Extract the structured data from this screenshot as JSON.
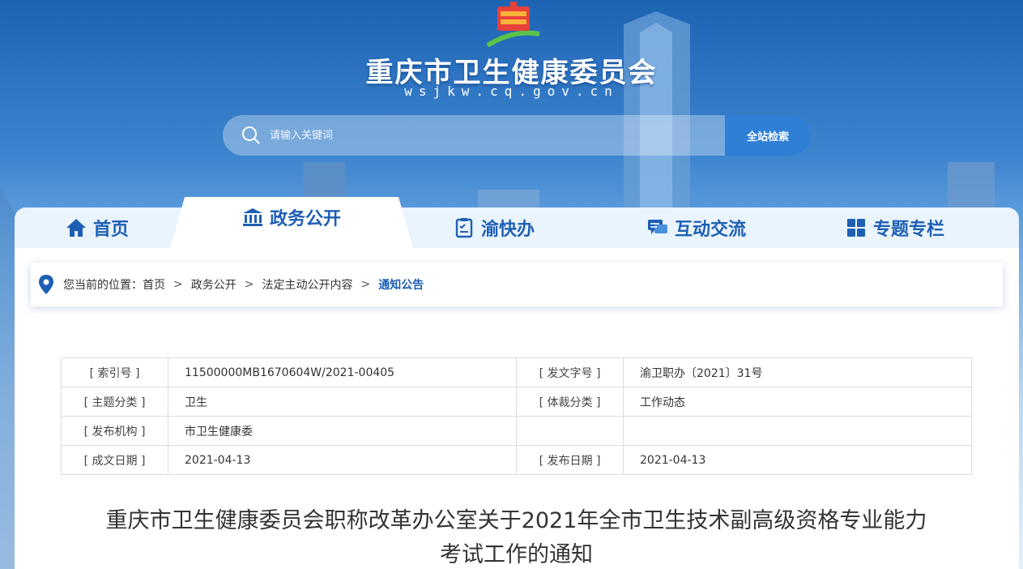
{
  "header": {
    "site_title": "重庆市卫生健康委员会",
    "site_domain": "wsjkw.cq.gov.cn"
  },
  "search": {
    "placeholder": "请输入关键词",
    "button_label": "全站检索"
  },
  "nav": {
    "items": [
      {
        "label": "首页",
        "icon": "home-icon"
      },
      {
        "label": "政务公开",
        "icon": "government-building-icon",
        "active": true
      },
      {
        "label": "渝快办",
        "icon": "clipboard-check-icon"
      },
      {
        "label": "互动交流",
        "icon": "chat-bubbles-icon"
      },
      {
        "label": "专题专栏",
        "icon": "grid-squares-icon"
      }
    ]
  },
  "breadcrumb": {
    "prefix": "您当前的位置：",
    "items": [
      "首页",
      "政务公开",
      "法定主动公开内容"
    ],
    "current": "通知公告",
    "separator": ">"
  },
  "meta": {
    "rows": [
      {
        "k1": "[ 索引号 ]",
        "v1": "11500000MB1670604W/2021-00405",
        "k2": "[ 发文字号 ]",
        "v2": "渝卫职办〔2021〕31号"
      },
      {
        "k1": "[ 主题分类 ]",
        "v1": "卫生",
        "k2": "[ 体裁分类 ]",
        "v2": "工作动态"
      },
      {
        "k1": "[ 发布机构 ]",
        "v1": "市卫生健康委",
        "k2": "",
        "v2": ""
      },
      {
        "k1": "[ 成文日期 ]",
        "v1": "2021-04-13",
        "k2": "[ 发布日期 ]",
        "v2": "2021-04-13"
      }
    ]
  },
  "article": {
    "title_line1": "重庆市卫生健康委员会职称改革办公室关于2021年全市卫生技术副高级资格专业能力",
    "title_line2": "考试工作的通知"
  },
  "colors": {
    "accent": "#1e5fb4",
    "button": "#2f7fd6"
  }
}
